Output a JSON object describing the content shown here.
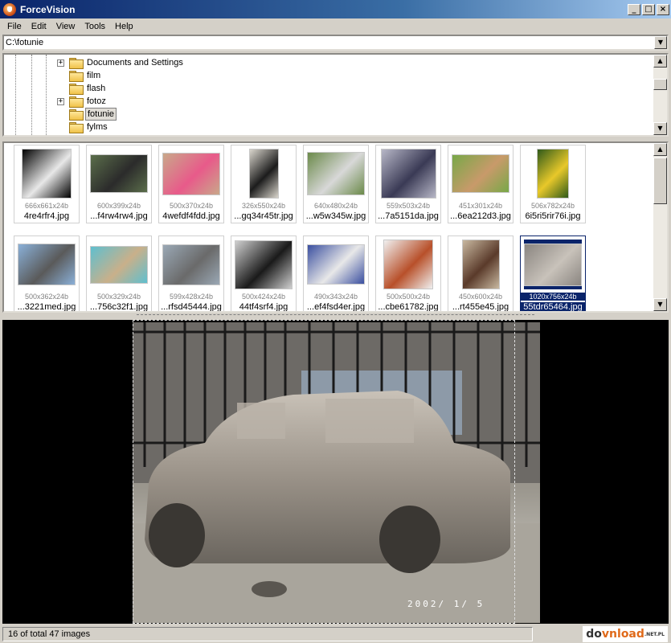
{
  "window": {
    "title": "ForceVision",
    "controls": [
      "_",
      "□",
      "×"
    ]
  },
  "menu": [
    "File",
    "Edit",
    "View",
    "Tools",
    "Help"
  ],
  "path": {
    "value": "C:\\fotunie",
    "dropdown_icon": "▼"
  },
  "tree": {
    "items": [
      {
        "label": "Documents and Settings",
        "expandable": true,
        "selected": false
      },
      {
        "label": "film",
        "expandable": false,
        "selected": false
      },
      {
        "label": "flash",
        "expandable": false,
        "selected": false
      },
      {
        "label": "fotoz",
        "expandable": true,
        "selected": false
      },
      {
        "label": "fotunie",
        "expandable": false,
        "selected": true
      },
      {
        "label": "fylms",
        "expandable": false,
        "selected": false
      }
    ],
    "scroll_up_icon": "▲",
    "scroll_down_icon": "▼"
  },
  "thumbnails": {
    "row1": [
      {
        "dims": "666x661x24b",
        "name": "4re4rfr4.jpg",
        "colors": [
          "#000000",
          "#e8e8e8"
        ]
      },
      {
        "dims": "600x399x24b",
        "name": "...f4rw4rw4.jpg",
        "colors": [
          "#5b6e4b",
          "#2b2b2b"
        ]
      },
      {
        "dims": "500x370x24b",
        "name": "4wefdf4fdd.jpg",
        "colors": [
          "#c9a88a",
          "#e85a8a"
        ]
      },
      {
        "dims": "326x550x24b",
        "name": "...gq34r45tr.jpg",
        "colors": [
          "#d9d5cc",
          "#1c1c1c"
        ]
      },
      {
        "dims": "640x480x24b",
        "name": "...w5w345w.jpg",
        "colors": [
          "#6b8a4a",
          "#d8d8d8"
        ]
      },
      {
        "dims": "559x503x24b",
        "name": "...7a5151da.jpg",
        "colors": [
          "#b7b7c7",
          "#3a3a55"
        ]
      },
      {
        "dims": "451x301x24b",
        "name": "...6ea212d3.jpg",
        "colors": [
          "#78a848",
          "#c89a6a"
        ]
      },
      {
        "dims": "506x782x24b",
        "name": "6i5ri5rir76i.jpg",
        "colors": [
          "#2f5a1a",
          "#e8c82a"
        ]
      }
    ],
    "row2": [
      {
        "dims": "500x362x24b",
        "name": "...3221med.jpg",
        "colors": [
          "#8ab0d8",
          "#5a5a5a"
        ],
        "selected": false
      },
      {
        "dims": "500x329x24b",
        "name": "...756c32f1.jpg",
        "colors": [
          "#5fbfcf",
          "#c9b08a"
        ],
        "selected": false
      },
      {
        "dims": "599x428x24b",
        "name": "...rfsd45444.jpg",
        "colors": [
          "#9aa8b5",
          "#6a6a6a"
        ],
        "selected": false
      },
      {
        "dims": "500x424x24b",
        "name": "44tf4srf4.jpg",
        "colors": [
          "#cfcfcf",
          "#1a1a1a"
        ],
        "selected": false
      },
      {
        "dims": "490x343x24b",
        "name": "...ef4fsd4er.jpg",
        "colors": [
          "#3a4fa0",
          "#e8e8e8"
        ],
        "selected": false
      },
      {
        "dims": "500x500x24b",
        "name": "...cbe61782.jpg",
        "colors": [
          "#f0f0f0",
          "#b8502a"
        ],
        "selected": false
      },
      {
        "dims": "450x600x24b",
        "name": "...rt455e45.jpg",
        "colors": [
          "#c8b8a0",
          "#5a3a2a"
        ],
        "selected": false
      },
      {
        "dims": "1020x756x24b",
        "name": "55tdr65464.jpg",
        "colors": [
          "#8a8580",
          "#c8c2ba"
        ],
        "selected": true
      }
    ]
  },
  "preview": {
    "date_stamp": "2002/ 1/ 5"
  },
  "status": {
    "text": "16 of total 47 images"
  },
  "watermark": {
    "text_a": "do",
    "text_b": "vnload",
    "text_c": ".NET.PL"
  },
  "colors": {
    "selection": "#0a246a",
    "title_gradient_start": "#0a246a",
    "window_face": "#d4d0c8"
  }
}
